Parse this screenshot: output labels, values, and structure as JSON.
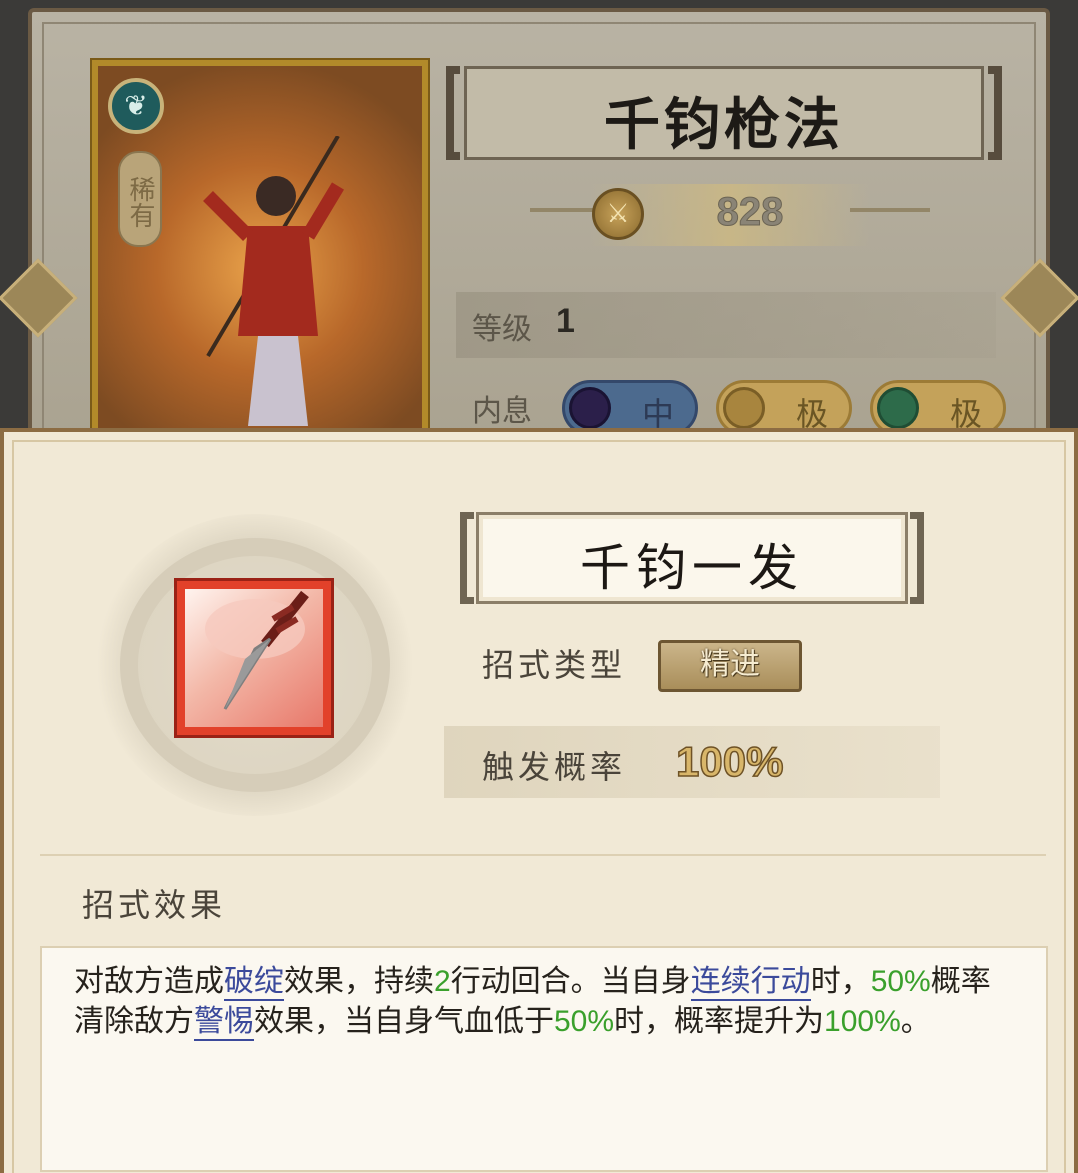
{
  "character_card": {
    "emblem_icon": "fan-emblem-icon",
    "rarity": "稀有"
  },
  "skill": {
    "name": "千钧枪法",
    "power_icon": "sword-medal-icon",
    "power": "828",
    "level_label": "等级",
    "level": "1",
    "neixi_label": "内息",
    "neixi": [
      {
        "icon": "moon-orb-icon",
        "grade": "中"
      },
      {
        "icon": "sun-orb-icon",
        "grade": "极"
      },
      {
        "icon": "jade-orb-icon",
        "grade": "极"
      }
    ]
  },
  "move": {
    "name": "千钧一发",
    "icon": "spear-strike-icon",
    "type_label": "招式类型",
    "type": "精进",
    "rate_label": "触发概率",
    "rate": "100%",
    "effect_label": "招式效果",
    "effect": {
      "t1": "对敌方造成",
      "k1": "破绽",
      "t2": "效果，持续",
      "n1": "2",
      "t3": "行动回合。当自身",
      "k2": "连续行动",
      "t4": "时，",
      "n2": "50%",
      "t5": "概率清除敌方",
      "k3": "警惕",
      "t6": "效果，当自身气血低于",
      "n3": "50%",
      "t7": "时，概率提升为",
      "n4": "100%",
      "t8": "。"
    }
  },
  "colors": {
    "highlight_number": "#3aa02c",
    "keyword_link": "#3b4a9b",
    "panel_bg": "#f1e9d6"
  }
}
